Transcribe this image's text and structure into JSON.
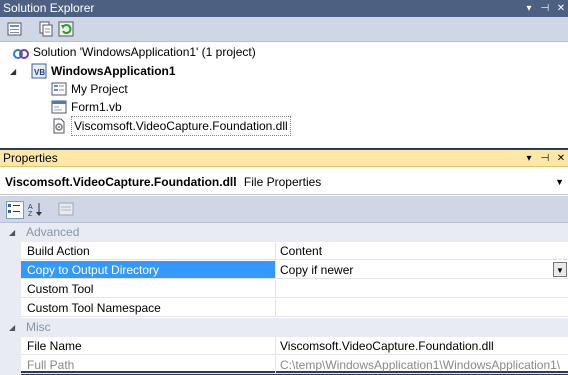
{
  "solution_explorer": {
    "title": "Solution Explorer",
    "controls": [
      "▾",
      "⊣",
      "✕"
    ],
    "tree": {
      "solution": "Solution 'WindowsApplication1' (1 project)",
      "project": "WindowsApplication1",
      "items": [
        "My Project",
        "Form1.vb",
        "Viscomsoft.VideoCapture.Foundation.dll"
      ]
    }
  },
  "properties": {
    "title": "Properties",
    "controls": [
      "▾",
      "⊣",
      "✕"
    ],
    "object_name": "Viscomsoft.VideoCapture.Foundation.dll",
    "object_type": "File Properties",
    "categories": [
      {
        "name": "Advanced",
        "rows": [
          {
            "name": "Build Action",
            "value": "Content"
          },
          {
            "name": "Copy to Output Directory",
            "value": "Copy if newer"
          },
          {
            "name": "Custom Tool",
            "value": ""
          },
          {
            "name": "Custom Tool Namespace",
            "value": ""
          }
        ]
      },
      {
        "name": "Misc",
        "rows": [
          {
            "name": "File Name",
            "value": "Viscomsoft.VideoCapture.Foundation.dll"
          },
          {
            "name": "Full Path",
            "value": "C:\\temp\\WindowsApplication1\\WindowsApplication1\\"
          }
        ]
      }
    ]
  },
  "icons": {
    "solution": "solution-icon",
    "project": "vb-project-icon",
    "my_project": "properties-icon",
    "form": "form-icon",
    "reference": "reference-dll-icon"
  },
  "colors": {
    "title_dark": "#4d6082",
    "title_active": "#ffe8a6",
    "selection": "#3399ff",
    "toolbar": "#cfd6e5"
  }
}
